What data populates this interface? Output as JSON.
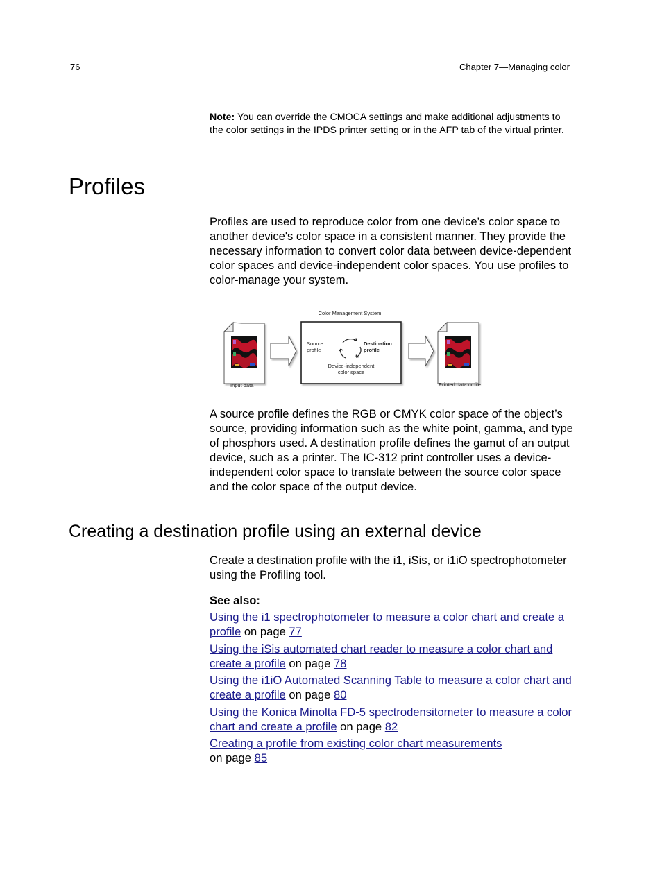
{
  "header": {
    "page_number": "76",
    "chapter": "Chapter 7—Managing color"
  },
  "note": {
    "label": "Note:",
    "text": " You can override the CMOCA settings and make additional adjustments to the color settings in the IPDS printer setting or in the AFP tab of the virtual printer."
  },
  "section": {
    "title": "Profiles",
    "paragraph1": "Profiles are used to reproduce color from one device’s color space to another device's color space in a consistent manner. They provide the necessary information to convert color data between device-dependent color spaces and device-independent color spaces. You use profiles to color-manage your system.",
    "paragraph2": "A source profile defines the RGB or CMYK color space of the object’s source, providing information such as the white point, gamma, and type of phosphors used. A destination profile defines the gamut of an output device, such as a printer. The IC-312 print controller uses a device-independent color space to translate between the source color space and the color space of the output device."
  },
  "diagram": {
    "title": "Color Management System",
    "input_label": "Input data",
    "output_label": "Printed data or file",
    "source_line1": "Source",
    "source_line2": "profile",
    "dest_line1": "Destination",
    "dest_line2": "profile",
    "center_line1": "Device-independent",
    "center_line2": "color space"
  },
  "subsection": {
    "title": "Creating a destination profile using an external device",
    "paragraph": "Create a destination profile with the i1, iSis, or i1iO spectrophotometer using the Profiling tool.",
    "see_also_label": "See also:",
    "links": [
      {
        "text": "Using the i1 spectrophotometer to measure a color chart and create a profile",
        "suffix": " on page ",
        "page": "77"
      },
      {
        "text": "Using the iSis automated chart reader to measure a color chart and create a profile",
        "suffix": " on page ",
        "page": "78"
      },
      {
        "text": "Using the i1iO Automated Scanning Table to measure a color chart and create a profile",
        "suffix": " on page ",
        "page": "80"
      },
      {
        "text": "Using the Konica Minolta FD-5 spectrodensitometer to measure a color chart and create a profile",
        "suffix": " on page ",
        "page": "82"
      },
      {
        "text": "Creating a profile from existing color chart measurements",
        "suffix": " on page ",
        "page": "85",
        "break_before_suffix": true
      }
    ]
  },
  "colors": {
    "link": "#1a1a8c",
    "text": "#000000"
  }
}
